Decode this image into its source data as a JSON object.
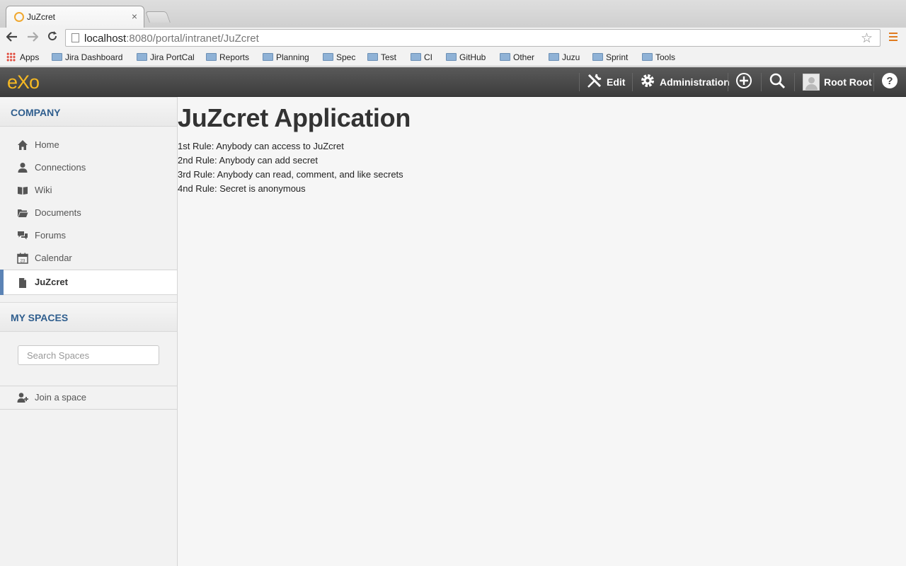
{
  "browser": {
    "tab_title": "JuZcret",
    "tab_close": "×",
    "url_host": "localhost",
    "url_rest": ":8080/portal/intranet/JuZcret",
    "bookmarks": [
      "Apps",
      "Jira Dashboard",
      "Jira PortCal",
      "Reports",
      "Planning",
      "Spec",
      "Test",
      "CI",
      "GitHub",
      "Other",
      "Juzu",
      "Sprint",
      "Tools"
    ]
  },
  "topbar": {
    "logo": "eXo",
    "edit_label": "Edit",
    "admin_label": "Administration",
    "user_name": "Root Root"
  },
  "sidebar": {
    "company_title": "COMPANY",
    "items": [
      {
        "label": "Home",
        "icon": "home-icon"
      },
      {
        "label": "Connections",
        "icon": "user-icon"
      },
      {
        "label": "Wiki",
        "icon": "book-icon"
      },
      {
        "label": "Documents",
        "icon": "folder-open-icon"
      },
      {
        "label": "Forums",
        "icon": "chat-icon"
      },
      {
        "label": "Calendar",
        "icon": "calendar-icon"
      },
      {
        "label": "JuZcret",
        "icon": "file-icon",
        "active": true
      }
    ],
    "spaces_title": "MY SPACES",
    "search_placeholder": "Search Spaces",
    "join_label": "Join a space",
    "active_color": "#5b83b5"
  },
  "main": {
    "title": "JuZcret Application",
    "rules": [
      "1st Rule: Anybody can access to JuZcret",
      "2nd Rule: Anybody can add secret",
      "3rd Rule: Anybody can read, comment, and like secrets",
      "4nd Rule: Secret is anonymous"
    ]
  }
}
